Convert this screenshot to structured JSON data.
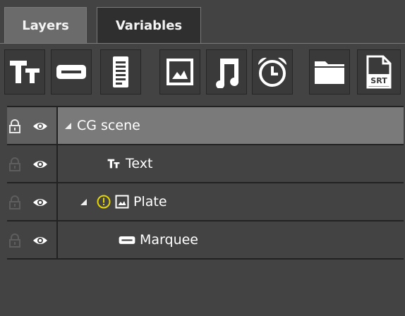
{
  "tabs": [
    {
      "label": "Layers",
      "active": true
    },
    {
      "label": "Variables",
      "active": false
    }
  ],
  "toolbar": {
    "items": [
      {
        "icon": "text-icon"
      },
      {
        "icon": "marquee-icon"
      },
      {
        "icon": "document-icon"
      },
      {
        "icon": "image-icon"
      },
      {
        "icon": "music-icon"
      },
      {
        "icon": "alarm-clock-icon"
      },
      {
        "icon": "folder-icon"
      },
      {
        "icon": "srt-file-icon",
        "badge": "SRT"
      }
    ]
  },
  "layers": [
    {
      "name": "CG scene",
      "icon": "",
      "expanded": true,
      "selected": true
    },
    {
      "name": "Text",
      "icon": "text-icon",
      "expanded": false,
      "selected": false
    },
    {
      "name": "Plate",
      "icon": "image-icon",
      "warning": true,
      "expanded": true,
      "selected": false
    },
    {
      "name": "Marquee",
      "icon": "marquee-icon",
      "expanded": false,
      "selected": false
    }
  ],
  "colors": {
    "background": "#434343",
    "selected_row": "#7a7a7a",
    "warning": "#e6d700"
  }
}
